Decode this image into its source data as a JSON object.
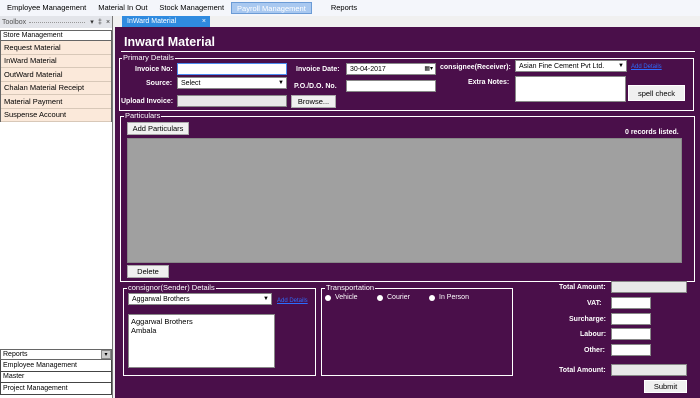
{
  "menu": {
    "items": [
      "Employee Management",
      "Material In  Out",
      "Stock Management",
      "Payroll Management",
      "Reports"
    ]
  },
  "toolbox": {
    "header": "Toolbox",
    "pin_glyph": "▾",
    "pin2_glyph": "‡",
    "close_glyph": "×",
    "section_store": "Store Management",
    "store_items": [
      "Request Material",
      "InWard Material",
      "OutWard Material",
      "Chalan Material Receipt",
      "Material Payment",
      "Suspense Account"
    ],
    "section_reports": "Reports",
    "bottom_items": [
      "Employee Management",
      "Master",
      "Project Management"
    ]
  },
  "tab": {
    "label": "InWard Material",
    "close": "×"
  },
  "form": {
    "title": "Inward Material",
    "primary_legend": "Primary Details",
    "invoice_no_label": "Invoice No:",
    "invoice_no_value": "",
    "source_label": "Source:",
    "source_value": "Select",
    "upload_label": "Upload Invoice:",
    "browse_label": "Browse...",
    "invoice_date_label": "Invoice Date:",
    "invoice_date_value": "30-04-2017",
    "po_label": "P.O./D.O. No.",
    "po_value": "",
    "consignee_label": "consignee(Receiver):",
    "consignee_value": "Asian Fine Cement Pvt Ltd.",
    "consignee_link": "Add Details",
    "extra_notes_label": "Extra Notes:",
    "extra_notes_value": "",
    "spell_check_label": "spell check",
    "particulars_legend": "Particulars",
    "add_particulars_label": "Add Particulars",
    "records_text": "0 records listed.",
    "delete_label": "Delete",
    "consignor_legend": "consignor(Sender) Details",
    "consignor_value": "Aggarwal Brothers",
    "consignor_link": "Add Details",
    "consignor_address": [
      "Aggarwal Brothers",
      "Ambala"
    ],
    "transport_legend": "Transportation",
    "transport_options": [
      "Vehicle",
      "Courier",
      "In Person"
    ],
    "total_amount_label": "Total Amount:",
    "vat_label": "VAT:",
    "surcharge_label": "Surcharge:",
    "labour_label": "Labour:",
    "other_label": "Other:",
    "total_amount2_label": "Total Amount:",
    "submit_label": "Submit"
  },
  "colors": {
    "form_bg": "#4a0f4a",
    "tab_active": "#2f8be0",
    "toolbox_item": "#fbe9da",
    "grid_bg": "#a0a0a0"
  }
}
